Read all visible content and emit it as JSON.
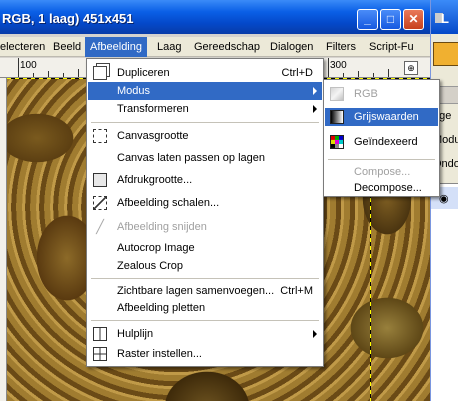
{
  "window": {
    "title": "RGB, 1 laag) 451x451",
    "btn_minimize": "_",
    "btn_maximize": "□",
    "btn_close": "✕"
  },
  "menubar": [
    {
      "label": "electeren"
    },
    {
      "label": "Beeld"
    },
    {
      "label": "Afbeelding"
    },
    {
      "label": "Laag"
    },
    {
      "label": "Gereedschap"
    },
    {
      "label": "Dialogen"
    },
    {
      "label": "Filters"
    },
    {
      "label": "Script-Fu"
    }
  ],
  "ruler": {
    "label_100": "100",
    "label_300": "300",
    "nav_icon": "navigate-icon"
  },
  "menu_afbeelding": {
    "items": [
      {
        "label": "Dupliceren",
        "shortcut": "Ctrl+D",
        "icon": "duplicate-icon"
      },
      {
        "label": "Modus",
        "submenu": true
      },
      {
        "label": "Transformeren",
        "submenu": true
      },
      {
        "label": "Canvasgrootte",
        "icon": "canvas-size-icon"
      },
      {
        "label": "Canvas laten passen op lagen"
      },
      {
        "label": "Afdrukgrootte...",
        "icon": "print-size-icon"
      },
      {
        "label": "Afbeelding schalen...",
        "icon": "scale-image-icon"
      },
      {
        "label": "Afbeelding snijden",
        "disabled": true,
        "icon": "crop-icon"
      },
      {
        "label": "Autocrop Image"
      },
      {
        "label": "Zealous Crop"
      },
      {
        "label": "Zichtbare lagen samenvoegen...",
        "shortcut": "Ctrl+M"
      },
      {
        "label": "Afbeelding pletten"
      },
      {
        "label": "Hulplijn",
        "submenu": true,
        "icon": "guide-icon"
      },
      {
        "label": "Raster instellen...",
        "icon": "grid-icon"
      }
    ]
  },
  "menu_modus": {
    "items": [
      {
        "label": "RGB",
        "disabled": true,
        "icon": "rgb-icon"
      },
      {
        "label": "Grijswaarden",
        "icon": "grayscale-icon"
      },
      {
        "label": "Geïndexeerd",
        "icon": "indexed-icon"
      },
      {
        "label": "Compose...",
        "disabled": true
      },
      {
        "label": "Decompose..."
      }
    ]
  },
  "dock": {
    "title": "L",
    "text_1": "age",
    "text_2": "Modu",
    "text_3": "Ondo"
  },
  "colors": {
    "highlight": "#316ac5",
    "titlebar": "#0a5fe6",
    "menu_bg": "#ffffff",
    "disabled_text": "#a0a0a0"
  }
}
